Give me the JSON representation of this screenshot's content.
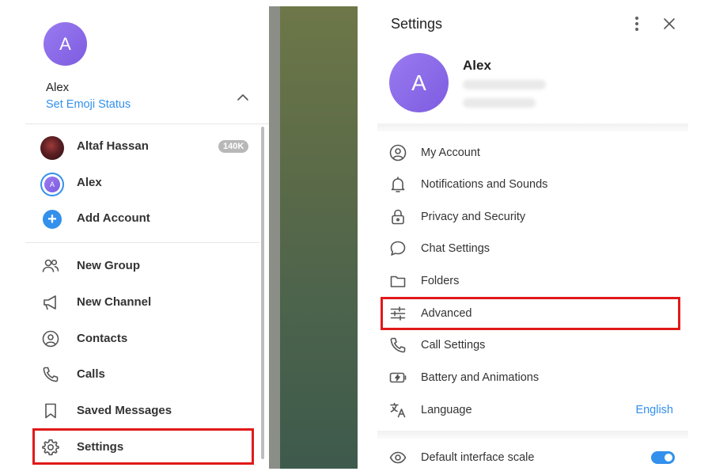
{
  "sidebar": {
    "avatar_letter": "A",
    "user_name": "Alex",
    "emoji_status_link": "Set Emoji Status",
    "accounts": [
      {
        "label": "Altaf Hassan",
        "badge": "140K"
      },
      {
        "label": "Alex",
        "avatar_letter": "A"
      },
      {
        "label": "Add Account",
        "icon": "plus-icon"
      }
    ],
    "menu": [
      {
        "label": "New Group",
        "icon": "users-icon"
      },
      {
        "label": "New Channel",
        "icon": "megaphone-icon"
      },
      {
        "label": "Contacts",
        "icon": "contact-icon"
      },
      {
        "label": "Calls",
        "icon": "phone-icon"
      },
      {
        "label": "Saved Messages",
        "icon": "bookmark-icon"
      },
      {
        "label": "Settings",
        "icon": "gear-icon"
      }
    ]
  },
  "settings": {
    "title": "Settings",
    "profile": {
      "avatar_letter": "A",
      "name": "Alex"
    },
    "items": [
      {
        "label": "My Account",
        "icon": "user-circle-icon"
      },
      {
        "label": "Notifications and Sounds",
        "icon": "bell-icon"
      },
      {
        "label": "Privacy and Security",
        "icon": "lock-icon"
      },
      {
        "label": "Chat Settings",
        "icon": "chat-bubble-icon"
      },
      {
        "label": "Folders",
        "icon": "folder-icon"
      },
      {
        "label": "Advanced",
        "icon": "sliders-icon"
      },
      {
        "label": "Call Settings",
        "icon": "phone-icon"
      },
      {
        "label": "Battery and Animations",
        "icon": "battery-icon"
      },
      {
        "label": "Language",
        "icon": "translate-icon",
        "value": "English"
      }
    ],
    "scale": {
      "label": "Default interface scale",
      "icon": "eye-icon",
      "enabled": true
    }
  },
  "colors": {
    "accent": "#3390ec",
    "highlight": "#e11919",
    "avatar": "#8a6ae8"
  }
}
